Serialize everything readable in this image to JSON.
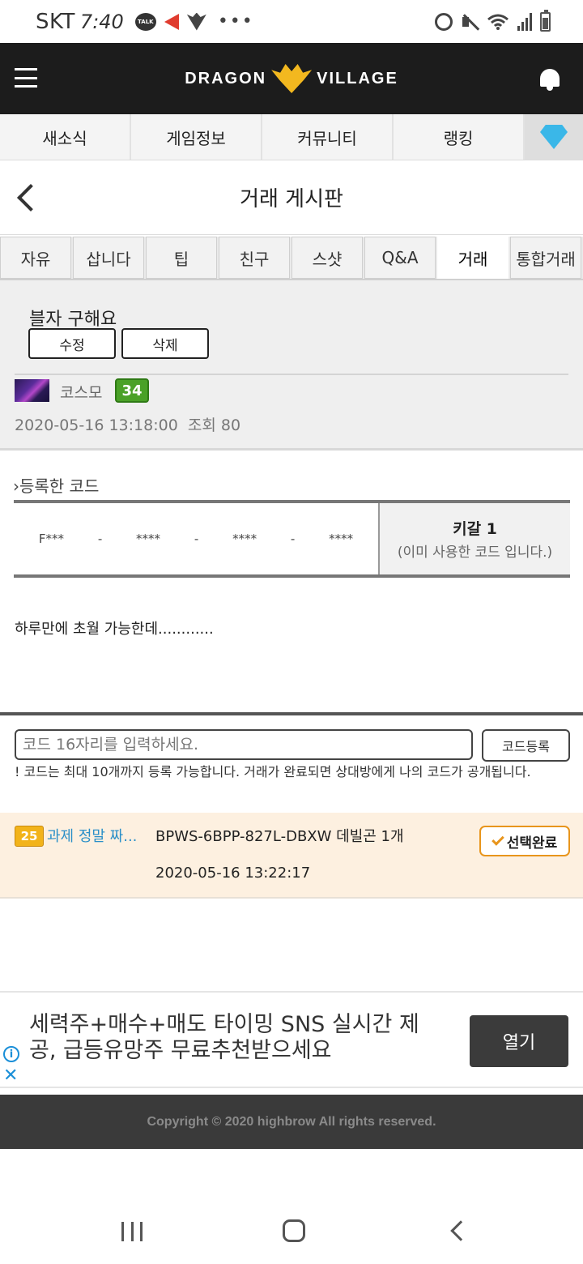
{
  "statusbar": {
    "carrier": "SKT",
    "time": "7:40",
    "icons_left": [
      "kakaotalk-icon",
      "megaphone-icon",
      "dv2-icon",
      "more-dots-icon"
    ],
    "icons_right": [
      "alarm-icon",
      "mute-icon",
      "wifi-icon",
      "signal-icon",
      "battery-icon"
    ],
    "talk_label": "TALK",
    "dots": "•••"
  },
  "header": {
    "logo_left": "DRAGON",
    "logo_right": "VILLAGE",
    "logo_color": "#f3b81f",
    "background": "#1c1c1c"
  },
  "topnav": {
    "items": [
      "새소식",
      "게임정보",
      "커뮤니티",
      "랭킹"
    ],
    "gem_color": "#3ab7e8"
  },
  "page": {
    "title": "거래 게시판"
  },
  "board_tabs": {
    "items": [
      "자유",
      "삽니다",
      "팁",
      "친구",
      "스샷",
      "Q&A",
      "거래",
      "통합거래"
    ],
    "active": "거래"
  },
  "post": {
    "title": "블자 구해요",
    "edit_label": "수정",
    "delete_label": "삭제",
    "author": "코스모",
    "level": "34",
    "datetime": "2020-05-16 13:18:00",
    "views_label": "조회 80",
    "body": "하루만에 초월 가능한데............"
  },
  "registered_code": {
    "heading": "등록한 코드",
    "parts": [
      "F***",
      "-",
      "****",
      "-",
      "****",
      "-",
      "****"
    ],
    "status_main": "키갈 1",
    "status_sub": "(이미 사용한 코드 입니다.)"
  },
  "code_input": {
    "placeholder": "코드 16자리를 입력하세요.",
    "register_label": "코드등록",
    "notice": "! 코드는 최대 10개까지 등록 가능합니다. 거래가 완료되면 상대방에게 나의 코드가 공개됩니다."
  },
  "reply": {
    "level": "25",
    "nickname": "과제 정말 짜...",
    "code_text": "BPWS-6BPP-827L-DBXW 데빌곤 1개",
    "datetime": "2020-05-16 13:22:17",
    "select_label": "선택완료",
    "accent": "#e8951c"
  },
  "ad": {
    "text": "세력주+매수+매도 타이밍 SNS 실시간 제공, 급등유망주 무료추천받으세요",
    "open_label": "열기",
    "info_label": "i",
    "close_label": "✕"
  },
  "footer": {
    "copyright": "Copyright © 2020 highbrow All rights reserved."
  }
}
